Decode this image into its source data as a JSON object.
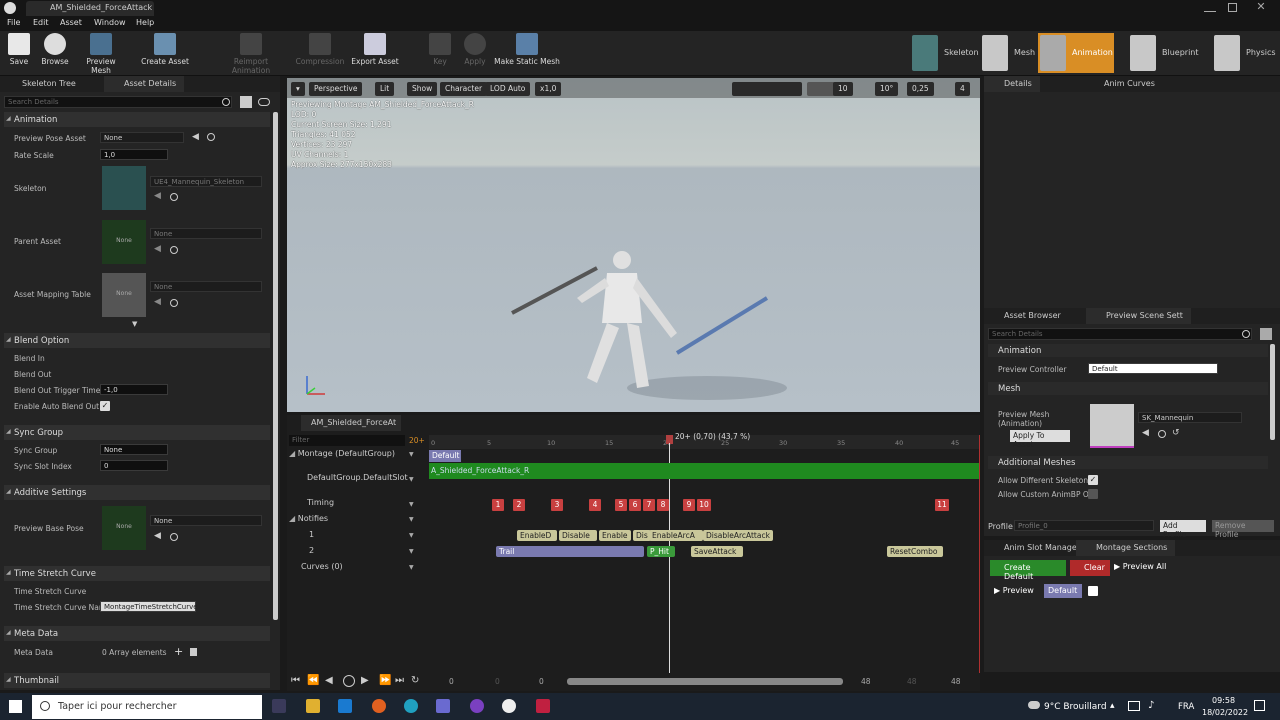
{
  "window": {
    "document_tab": "AM_Shielded_ForceAttack"
  },
  "menu": [
    "File",
    "Edit",
    "Asset",
    "Window",
    "Help"
  ],
  "toolbar": {
    "buttons": [
      {
        "label": "Save",
        "enabled": true
      },
      {
        "label": "Browse",
        "enabled": true
      },
      {
        "label": "Preview Mesh",
        "enabled": true
      },
      {
        "label": "Create Asset",
        "enabled": true
      },
      {
        "label": "Reimport Animation",
        "enabled": false
      },
      {
        "label": "Compression",
        "enabled": false
      },
      {
        "label": "Export Asset",
        "enabled": true
      },
      {
        "label": "Key",
        "enabled": false
      },
      {
        "label": "Apply",
        "enabled": false
      },
      {
        "label": "Make Static Mesh",
        "enabled": true
      }
    ],
    "modes": [
      "Skeleton",
      "Mesh",
      "Animation",
      "Blueprint",
      "Physics"
    ],
    "active_mode": "Animation"
  },
  "left_panel": {
    "tabs": [
      "Skeleton Tree",
      "Asset Details"
    ],
    "search_placeholder": "Search Details",
    "sections": {
      "animation": {
        "title": "Animation",
        "preview_pose_asset_label": "Preview Pose Asset",
        "preview_pose_asset_value": "None",
        "rate_scale_label": "Rate Scale",
        "rate_scale_value": "1,0",
        "skeleton_label": "Skeleton",
        "skeleton_value": "UE4_Mannequin_Skeleton",
        "parent_asset_label": "Parent Asset",
        "parent_asset_value": "None",
        "mapping_table_label": "Asset Mapping Table",
        "mapping_table_value": "None",
        "thumb_none": "None"
      },
      "blend_option": {
        "title": "Blend Option",
        "blend_in": "Blend In",
        "blend_out": "Blend Out",
        "trigger_time_label": "Blend Out Trigger Time",
        "trigger_time_value": "-1,0",
        "auto_blend_label": "Enable Auto Blend Out",
        "auto_blend_checked": true
      },
      "sync_group": {
        "title": "Sync Group",
        "sync_group_label": "Sync Group",
        "sync_group_value": "None",
        "sync_slot_label": "Sync Slot Index",
        "sync_slot_value": "0"
      },
      "additive": {
        "title": "Additive Settings",
        "preview_base_pose_label": "Preview Base Pose",
        "preview_base_pose_value": "None"
      },
      "time_stretch": {
        "title": "Time Stretch Curve",
        "curve_label": "Time Stretch Curve",
        "curve_name_label": "Time Stretch Curve Nam",
        "curve_name_value": "MontageTimeStretchCurve"
      },
      "meta": {
        "title": "Meta Data",
        "meta_label": "Meta Data",
        "meta_value": "0 Array elements"
      },
      "thumbnail": {
        "title": "Thumbnail"
      }
    }
  },
  "viewport": {
    "buttons": [
      "Perspective",
      "Lit",
      "Show",
      "Character",
      "LOD Auto",
      "x1,0"
    ],
    "snap_values": [
      "10",
      "10°",
      "0,25",
      "4"
    ],
    "stats": [
      "Previewing Montage AM_Shielded_ForceAttack_R",
      "LOD: 0",
      "Current Screen Size: 1,291",
      "Triangles: 41 052",
      "Vertices: 23 297",
      "UV Channels: 1",
      "Approx Size: 277x150x283"
    ]
  },
  "timeline": {
    "tab": "AM_Shielded_ForceAt",
    "filter_placeholder": "Filter",
    "frame_indicator": "20+",
    "playhead_label": "20+ (0,70) (43,7 %)",
    "ruler_ticks": [
      "0",
      "5",
      "10",
      "15",
      "20",
      "25",
      "30",
      "35",
      "40",
      "45"
    ],
    "montage_label": "Montage (DefaultGroup)",
    "section_name": "Default",
    "slot_label": "DefaultGroup.DefaultSlot",
    "slot_anim": "A_Shielded_ForceAttack_R",
    "timing_label": "Timing",
    "timing_markers": [
      "1",
      "2",
      "3",
      "4",
      "5",
      "6",
      "7",
      "8",
      "9",
      "10",
      "11"
    ],
    "notifies_label": "Notifies",
    "notify_track_1": "1",
    "notify_track_2": "2",
    "notifies_row1": [
      "EnableD",
      "Disable",
      "Enable",
      "Dis",
      "EnableArcA",
      "DisableArcAttack"
    ],
    "notifies_row2": [
      "Trail",
      "P_Hit",
      "SaveAttack",
      "ResetCombo"
    ],
    "curves_label": "Curves",
    "curves_count": "(0)",
    "transport_values": [
      "0",
      "0",
      "0",
      "48",
      "48",
      "48"
    ]
  },
  "right_top": {
    "tabs": [
      "Details",
      "Anim Curves"
    ]
  },
  "right_mid": {
    "tabs": [
      "Asset Browser",
      "Preview Scene Sett"
    ],
    "search_placeholder": "Search Details",
    "animation_title": "Animation",
    "preview_controller_label": "Preview Controller",
    "preview_controller_value": "Default",
    "mesh_title": "Mesh",
    "preview_mesh_label": "Preview Mesh (Animation)",
    "preview_mesh_value": "SK_Mannequin",
    "apply_to_asset": "Apply To Asset",
    "additional_meshes_title": "Additional Meshes",
    "allow_diff_skeletons": "Allow Different Skeletons",
    "allow_custom_animbp": "Allow Custom AnimBP Ov",
    "profile_label": "Profile",
    "profile_value": "Profile_0",
    "add_profile": "Add Profile",
    "remove_profile": "Remove Profile"
  },
  "right_bot": {
    "tabs": [
      "Anim Slot Manage",
      "Montage Sections"
    ],
    "create_default": "Create Default",
    "clear": "Clear",
    "preview_all": "Preview All",
    "preview": "Preview",
    "default_section": "Default"
  },
  "taskbar": {
    "search_placeholder": "Taper ici pour rechercher",
    "weather": "9°C Brouillard",
    "language": "FRA",
    "time": "09:58",
    "date": "18/02/2022"
  },
  "colors": {
    "accent_orange": "#d98e25",
    "slot_green": "#1f8a1f",
    "timing_red": "#c84040",
    "notify_tan": "#c9c79a"
  }
}
